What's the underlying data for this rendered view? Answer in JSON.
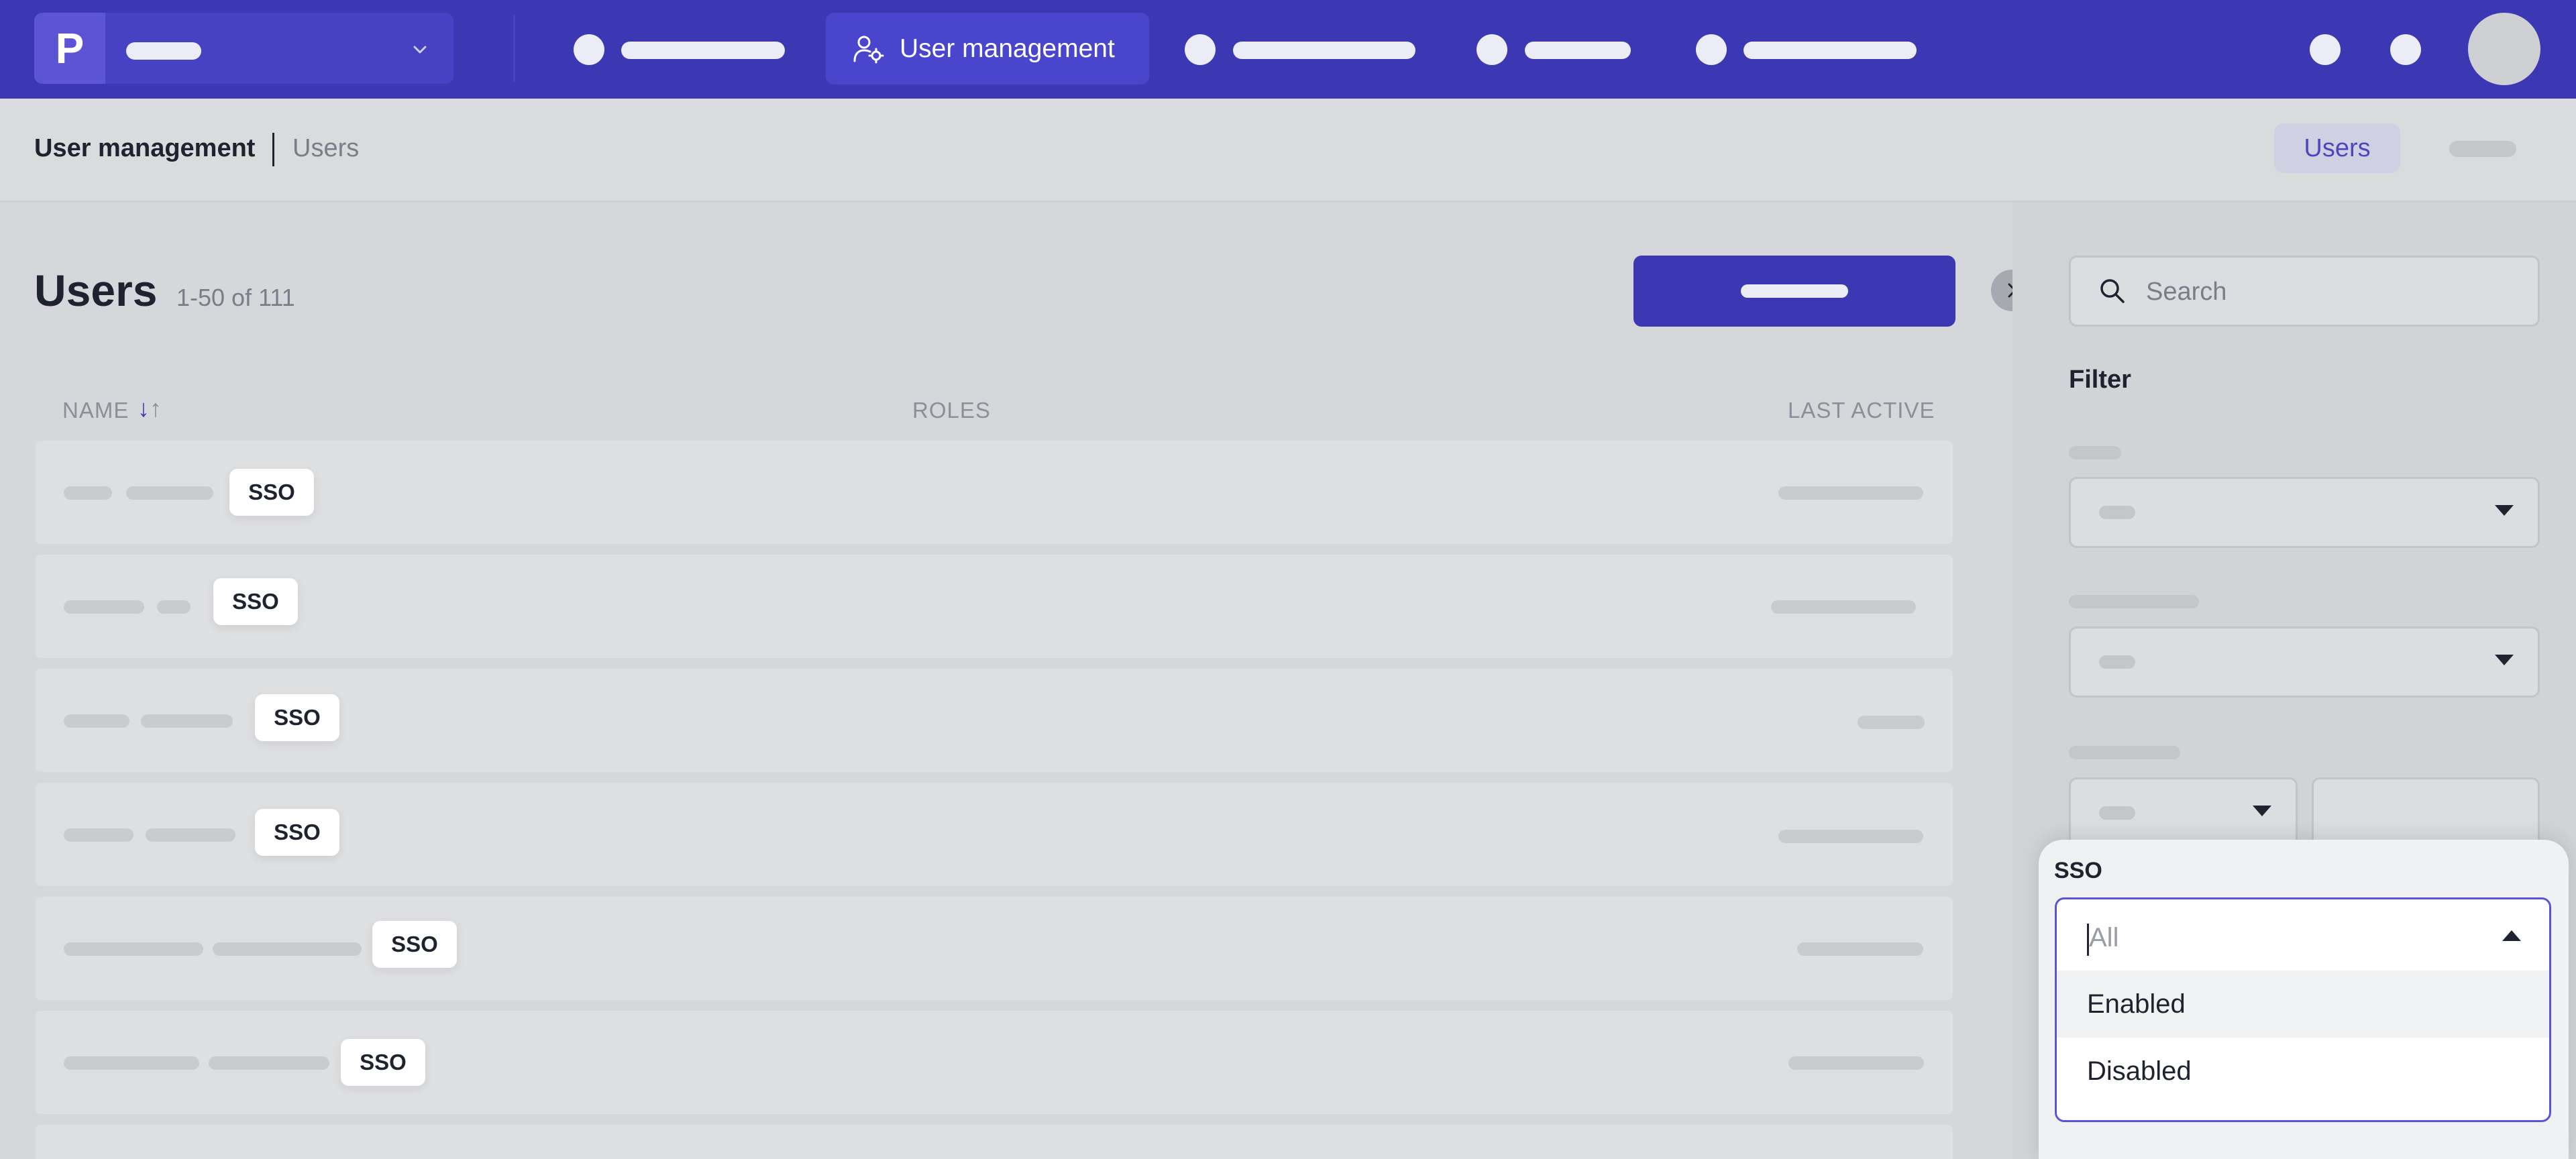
{
  "nav": {
    "active_label": "User management"
  },
  "breadcrumb": {
    "section": "User management",
    "page": "Users"
  },
  "subtabs": {
    "active": "Users"
  },
  "users": {
    "title": "Users",
    "count": "1-50 of 111",
    "columns": {
      "name": "NAME",
      "roles": "ROLES",
      "last_active": "LAST ACTIVE"
    },
    "sort_icons": "↓↑",
    "rows": [
      {
        "badge": "SSO"
      },
      {
        "badge": "SSO"
      },
      {
        "badge": "SSO"
      },
      {
        "badge": "SSO"
      },
      {
        "badge": "SSO"
      },
      {
        "badge": "SSO"
      }
    ]
  },
  "sidebar": {
    "search_placeholder": "Search",
    "filter_title": "Filter",
    "sso": {
      "label": "SSO",
      "placeholder": "All",
      "options": [
        "Enabled",
        "Disabled"
      ],
      "highlighted_option": "Enabled"
    }
  },
  "icons": {
    "brand": "brand-logo-icon",
    "brand_dropdown": "chevron-down-icon",
    "user_management": "user-gear-icon",
    "collapse": "chevron-right-icon",
    "search": "search-icon",
    "select_caret": "caret-down-icon",
    "dropdown_open": "caret-up-icon"
  },
  "colors": {
    "accent": "#3c37b3",
    "accent_text": "#4c47c0",
    "badge_bg": "#ffffff"
  }
}
